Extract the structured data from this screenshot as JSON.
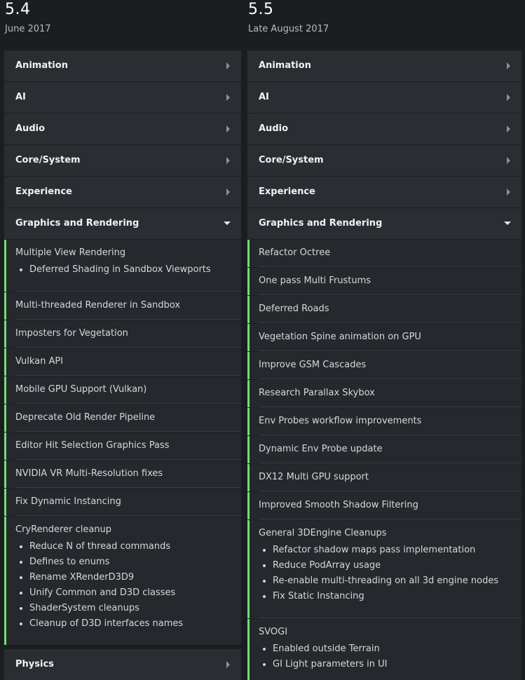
{
  "columns": [
    {
      "version": "5.4",
      "date": "June 2017",
      "categories_top": [
        "Animation",
        "AI",
        "Audio",
        "Core/System",
        "Experience"
      ],
      "expanded": {
        "label": "Graphics and Rendering",
        "items": [
          {
            "title": "Multiple View Rendering",
            "bullets": [
              "Deferred Shading in Sandbox Viewports"
            ]
          },
          {
            "title": "Multi-threaded Renderer in Sandbox",
            "bullets": []
          },
          {
            "title": "Imposters for Vegetation",
            "bullets": []
          },
          {
            "title": "Vulkan API",
            "bullets": []
          },
          {
            "title": "Mobile GPU Support (Vulkan)",
            "bullets": []
          },
          {
            "title": "Deprecate Old Render Pipeline",
            "bullets": []
          },
          {
            "title": "Editor Hit Selection Graphics Pass",
            "bullets": []
          },
          {
            "title": "NVIDIA VR Multi-Resolution fixes",
            "bullets": []
          },
          {
            "title": "Fix Dynamic Instancing",
            "bullets": []
          },
          {
            "title": "CryRenderer cleanup",
            "bullets": [
              "Reduce N of thread commands",
              "Defines to enums",
              "Rename XRenderD3D9",
              "Unify Common and D3D classes",
              "ShaderSystem cleanups",
              "Cleanup of D3D interfaces names"
            ]
          }
        ]
      },
      "categories_bottom": [
        "Physics"
      ]
    },
    {
      "version": "5.5",
      "date": "Late August 2017",
      "categories_top": [
        "Animation",
        "AI",
        "Audio",
        "Core/System",
        "Experience"
      ],
      "expanded": {
        "label": "Graphics and Rendering",
        "items": [
          {
            "title": "Refactor Octree",
            "bullets": []
          },
          {
            "title": "One pass Multi Frustums",
            "bullets": []
          },
          {
            "title": "Deferred Roads",
            "bullets": []
          },
          {
            "title": "Vegetation Spine animation on GPU",
            "bullets": []
          },
          {
            "title": "Improve GSM Cascades",
            "bullets": []
          },
          {
            "title": "Research Parallax Skybox",
            "bullets": []
          },
          {
            "title": "Env Probes workflow improvements",
            "bullets": []
          },
          {
            "title": "Dynamic Env Probe update",
            "bullets": []
          },
          {
            "title": "DX12 Multi GPU support",
            "bullets": []
          },
          {
            "title": "Improved Smooth Shadow Filtering",
            "bullets": []
          },
          {
            "title": "General 3DEngine Cleanups",
            "bullets": [
              "Refactor shadow maps pass implementation",
              "Reduce PodArray usage",
              "Re-enable multi-threading on all 3d engine nodes",
              "Fix Static Instancing"
            ]
          },
          {
            "title": "SVOGI",
            "bullets": [
              "Enabled outside Terrain",
              "GI Light parameters in UI"
            ]
          }
        ]
      },
      "categories_bottom": []
    }
  ],
  "colors": {
    "background": "#1b1e21",
    "category_bg": "#2a2d31",
    "item_bg": "#25282c",
    "accent_bar": "#6fe06f"
  },
  "icons": {
    "collapsed": "chevron-right-icon",
    "expanded": "chevron-down-icon"
  }
}
